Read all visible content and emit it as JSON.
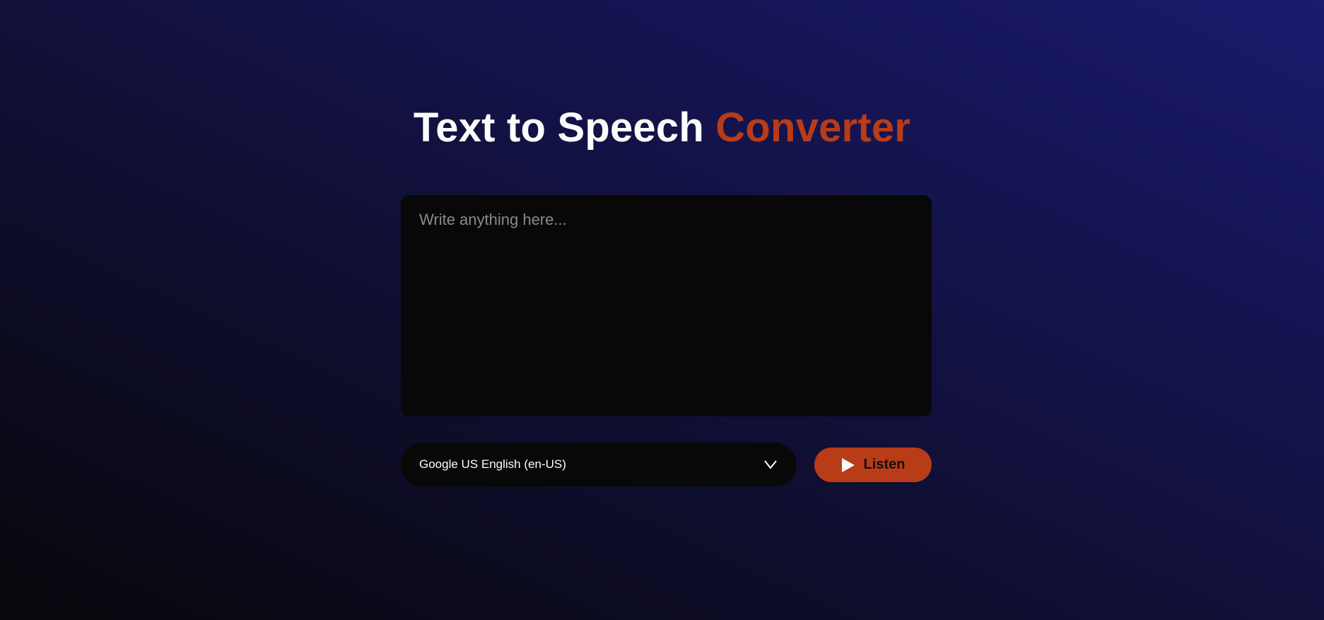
{
  "page": {
    "title_main": "Text to Speech ",
    "title_accent": "Converter"
  },
  "editor": {
    "placeholder": "Write anything here...",
    "value": ""
  },
  "voice_select": {
    "selected": "Google US English (en-US)",
    "icon": "chevron-down-icon"
  },
  "listen_button": {
    "label": "Listen",
    "icon": "play-icon"
  },
  "colors": {
    "accent": "#b83c18",
    "panel": "#080808",
    "text": "#ffffff",
    "placeholder": "#8a8a8a",
    "background_start": "#08080c",
    "background_end": "#1a1a6e"
  }
}
